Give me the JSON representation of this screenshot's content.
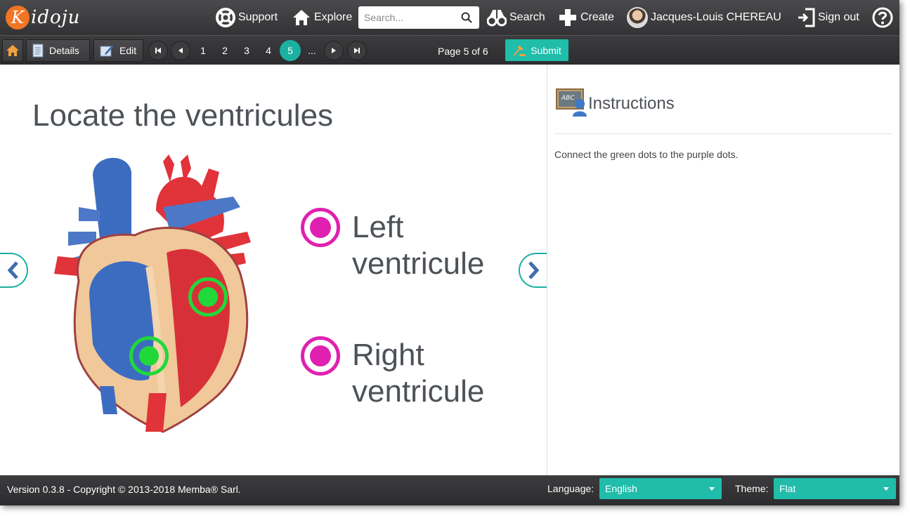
{
  "brand": {
    "first_letter": "K",
    "rest": "idoju"
  },
  "navbar": {
    "support_label": "Support",
    "explore_label": "Explore",
    "search_placeholder": "Search...",
    "search_label": "Search",
    "create_label": "Create",
    "user_name": "Jacques-Louis CHEREAU",
    "signout_label": "Sign out"
  },
  "toolbar": {
    "details_label": "Details",
    "edit_label": "Edit",
    "pages": [
      "1",
      "2",
      "3",
      "4",
      "5"
    ],
    "active_page": "5",
    "ellipsis": "...",
    "page_info": "Page 5 of 6",
    "submit_label": "Submit"
  },
  "stage": {
    "title": "Locate the ventricules",
    "labels": [
      {
        "text": "Left\nventricule"
      },
      {
        "text": "Right\nventricule"
      }
    ]
  },
  "sidepanel": {
    "title": "Instructions",
    "text": "Connect the green dots to the purple dots.",
    "icon_text": "ABC"
  },
  "footer": {
    "version": "Version 0.3.8 - Copyright © 2013-2018 Memba® Sarl.",
    "language_label": "Language:",
    "language_value": "English",
    "theme_label": "Theme:",
    "theme_value": "Flat"
  },
  "colors": {
    "accent": "#1ab1a2",
    "logo_orange": "#f07524",
    "green_dot": "#21d83a",
    "purple_dot": "#e020b0"
  }
}
